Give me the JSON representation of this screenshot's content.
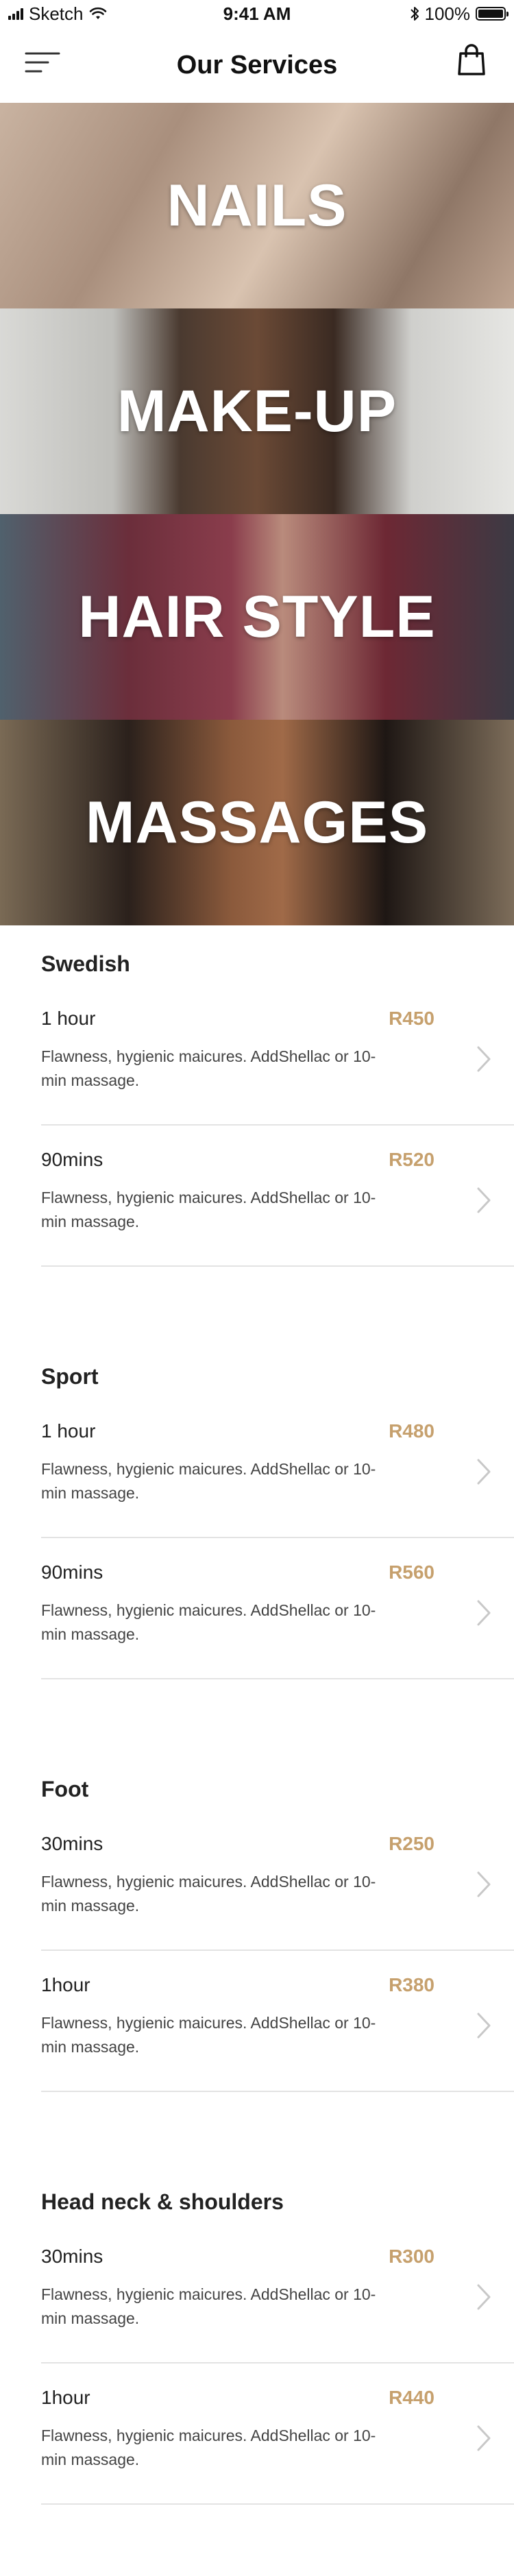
{
  "status_bar": {
    "carrier": "Sketch",
    "time": "9:41 AM",
    "battery": "100%"
  },
  "nav": {
    "title": "Our Services"
  },
  "banners": [
    {
      "label": "NAILS"
    },
    {
      "label": "MAKE-UP"
    },
    {
      "label": "HAIR STYLE"
    },
    {
      "label": "MASSAGES"
    }
  ],
  "sections": [
    {
      "title": "Swedish",
      "items": [
        {
          "duration": "1 hour",
          "price": "R450",
          "description": "Flawness, hygienic maicures. AddShellac or 10-min massage."
        },
        {
          "duration": "90mins",
          "price": "R520",
          "description": "Flawness, hygienic maicures. AddShellac or 10-min massage."
        }
      ]
    },
    {
      "title": "Sport",
      "items": [
        {
          "duration": "1 hour",
          "price": "R480",
          "description": "Flawness, hygienic maicures. AddShellac or 10-min massage."
        },
        {
          "duration": "90mins",
          "price": "R560",
          "description": "Flawness, hygienic maicures. AddShellac or 10-min massage."
        }
      ]
    },
    {
      "title": "Foot",
      "items": [
        {
          "duration": "30mins",
          "price": "R250",
          "description": "Flawness, hygienic maicures. AddShellac or 10-min massage."
        },
        {
          "duration": "1hour",
          "price": "R380",
          "description": "Flawness, hygienic maicures. AddShellac or 10-min massage."
        }
      ]
    },
    {
      "title": "Head neck & shoulders",
      "items": [
        {
          "duration": "30mins",
          "price": "R300",
          "description": "Flawness, hygienic maicures. AddShellac or 10-min massage."
        },
        {
          "duration": "1hour",
          "price": "R440",
          "description": "Flawness, hygienic maicures. AddShellac or 10-min massage."
        }
      ]
    }
  ],
  "icons": {
    "menu": "menu-icon",
    "cart": "shopping-bag-icon",
    "chevron": "chevron-right-icon",
    "signal": "signal-icon",
    "wifi": "wifi-icon",
    "bluetooth": "bluetooth-icon",
    "battery": "battery-icon"
  },
  "colors": {
    "price": "#c6a06d",
    "divider": "#e3e3e3",
    "text": "#222222"
  }
}
